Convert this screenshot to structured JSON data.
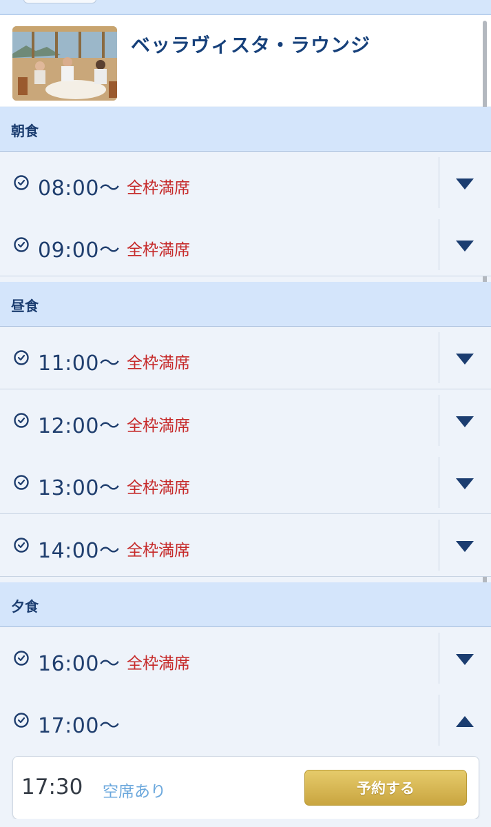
{
  "restaurant": {
    "name": "ベッラヴィスタ・ラウンジ"
  },
  "sections": [
    {
      "label": "朝食",
      "slots": [
        {
          "time": "08:00〜",
          "status": "全枠満席",
          "expanded": false
        },
        {
          "time": "09:00〜",
          "status": "全枠満席",
          "expanded": false
        }
      ]
    },
    {
      "label": "昼食",
      "slots": [
        {
          "time": "11:00〜",
          "status": "全枠満席",
          "expanded": false
        },
        {
          "time": "12:00〜",
          "status": "全枠満席",
          "expanded": false
        },
        {
          "time": "13:00〜",
          "status": "全枠満席",
          "expanded": false
        },
        {
          "time": "14:00〜",
          "status": "全枠満席",
          "expanded": false
        }
      ]
    },
    {
      "label": "夕食",
      "slots": [
        {
          "time": "16:00〜",
          "status": "全枠満席",
          "expanded": false
        },
        {
          "time": "17:00〜",
          "status": "",
          "expanded": true
        }
      ]
    }
  ],
  "expanded_detail": {
    "time": "17:30",
    "status": "空席あり",
    "button_label": "予約する"
  },
  "icons": {
    "clock": "clock-icon",
    "expand": "chevron-down-icon",
    "collapse": "chevron-up-icon"
  },
  "colors": {
    "header_bg": "#d4e5fb",
    "title": "#16407a",
    "full_status": "#c62a2a",
    "available_status": "#6aa7dc",
    "reserve_button": "#d8b955"
  }
}
